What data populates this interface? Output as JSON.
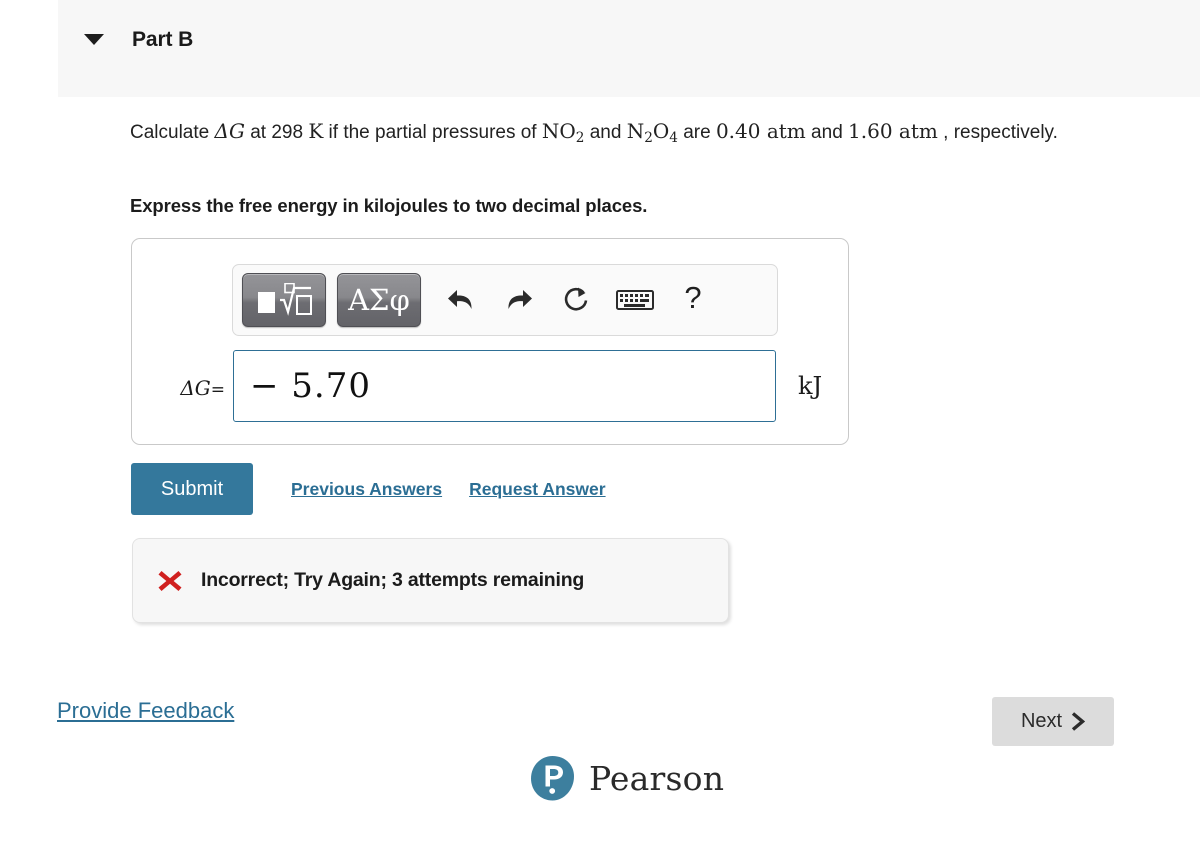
{
  "header": {
    "collapse_icon": "triangle-down-icon",
    "title": "Part B"
  },
  "question": {
    "line1_a": "Calculate ",
    "math_dg": "ΔG",
    "line1_b": " at 298 ",
    "math_k": "K",
    "line1_c": " if the partial pressures of ",
    "math_no2": "NO",
    "math_no2_sub": "2",
    "line1_d": " and ",
    "math_n2o4_n": "N",
    "math_n2o4_sub1": "2",
    "math_n2o4_o": "O",
    "math_n2o4_sub2": "4",
    "line1_e": " are ",
    "value1": "0.40 atm",
    "line1_f": " and ",
    "value2": "1.60 atm",
    "line1_g": " ,",
    "line2": "respectively.",
    "instruction": "Express the free energy in kilojoules to two decimal places."
  },
  "answer_area": {
    "toolbar": {
      "template_button": "math-template-icon",
      "greek_button": "ΑΣφ",
      "undo_icon": "undo-arrow-icon",
      "redo_icon": "redo-arrow-icon",
      "reset_icon": "reset-circular-arrow-icon",
      "keyboard_icon": "keyboard-icon",
      "help_icon": "?"
    },
    "variable_label": "ΔG",
    "equals_sign": "=",
    "input_value": "− 5.70",
    "input_placeholder": "",
    "unit": "kJ"
  },
  "actions": {
    "submit_label": "Submit",
    "previous_answers_label": "Previous Answers",
    "request_answer_label": "Request Answer"
  },
  "feedback": {
    "status_icon": "x-mark-icon",
    "message": "Incorrect; Try Again; 3 attempts remaining"
  },
  "footer": {
    "provide_feedback_label": "Provide Feedback",
    "next_label": "Next",
    "next_chevron": "chevron-right-icon",
    "brand_name": "Pearson"
  },
  "colors": {
    "accent_blue": "#34789c",
    "link_blue": "#2b6e94",
    "error_red": "#d0201f",
    "header_band": "#f7f7f7",
    "next_button": "#dcdcdc",
    "input_border": "#2e6f95",
    "brand_teal": "#3d7f9e"
  }
}
